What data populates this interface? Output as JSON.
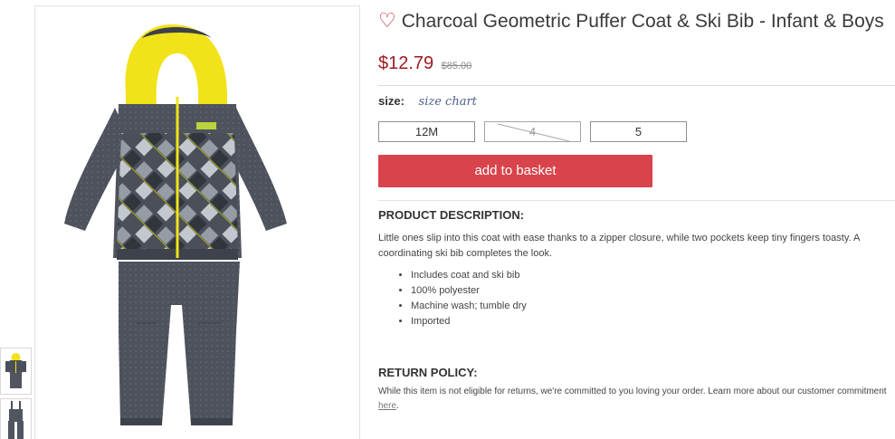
{
  "product": {
    "title": "Charcoal Geometric Puffer Coat & Ski Bib - Infant & Boys",
    "price": "$12.79",
    "original_price": "$85.00"
  },
  "size": {
    "label": "size:",
    "chart_link": "size chart",
    "options": [
      {
        "label": "12M",
        "available": true
      },
      {
        "label": "4",
        "available": false
      },
      {
        "label": "5",
        "available": true
      }
    ]
  },
  "actions": {
    "add_to_basket": "add to basket"
  },
  "description": {
    "heading": "PRODUCT DESCRIPTION:",
    "text": "Little ones slip into this coat with ease thanks to a zipper closure, while two pockets keep tiny fingers toasty. A coordinating ski bib completes the look.",
    "bullets": [
      "Includes coat and ski bib",
      "100% polyester",
      "Machine wash; tumble dry",
      "Imported"
    ]
  },
  "return_policy": {
    "heading": "RETURN POLICY:",
    "text": "While this item is not eligible for returns, we're committed to you loving your order. Learn more about our customer commitment",
    "link": "here",
    "suffix": "."
  },
  "icons": {
    "favorite": "heart-outline-icon"
  },
  "colors": {
    "price": "#9e1b20",
    "heart": "#c0272d",
    "basket_button": "#d9434b",
    "size_chart_link": "#4d5e8a",
    "jacket": "#4a4f59",
    "hood_lining": "#f1e21a"
  }
}
